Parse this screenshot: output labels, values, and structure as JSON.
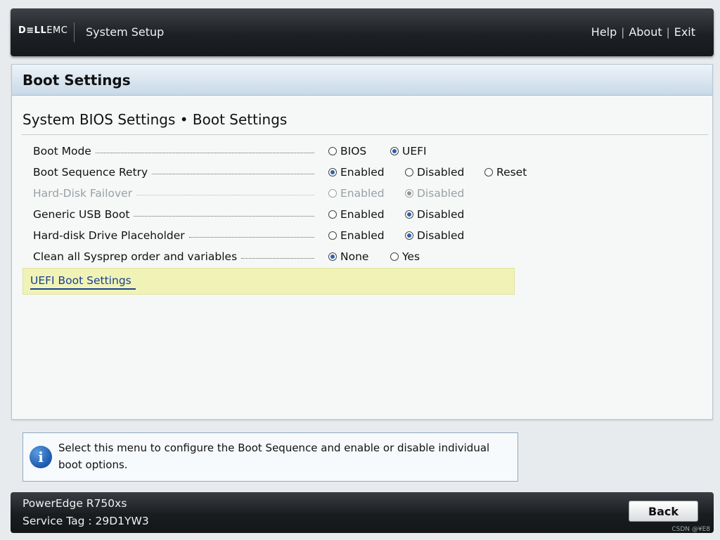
{
  "header": {
    "logo_dell": "D≡LL",
    "logo_emc": "EMC",
    "title": "System Setup",
    "links": [
      "Help",
      "About",
      "Exit"
    ],
    "separator": "|"
  },
  "panel": {
    "title": "Boot Settings",
    "breadcrumb": "System BIOS Settings • Boot Settings",
    "rows": [
      {
        "label": "Boot Mode",
        "disabled": false,
        "options": [
          "BIOS",
          "UEFI"
        ],
        "selected": 1
      },
      {
        "label": "Boot Sequence Retry",
        "disabled": false,
        "options": [
          "Enabled",
          "Disabled",
          "Reset"
        ],
        "selected": 0
      },
      {
        "label": "Hard-Disk Failover",
        "disabled": true,
        "options": [
          "Enabled",
          "Disabled"
        ],
        "selected": 1
      },
      {
        "label": "Generic USB Boot",
        "disabled": false,
        "options": [
          "Enabled",
          "Disabled"
        ],
        "selected": 1
      },
      {
        "label": "Hard-disk Drive Placeholder",
        "disabled": false,
        "options": [
          "Enabled",
          "Disabled"
        ],
        "selected": 1
      },
      {
        "label": "Clean all Sysprep order and variables",
        "disabled": false,
        "options": [
          "None",
          "Yes"
        ],
        "selected": 0
      }
    ],
    "submenu_link": "UEFI Boot Settings"
  },
  "info": {
    "icon": "info-icon",
    "text": "Select this menu to configure the Boot Sequence and enable or disable individual boot options."
  },
  "footer": {
    "model": "PowerEdge R750xs",
    "service_tag": "Service Tag : 29D1YW3",
    "back_label": "Back"
  },
  "watermark": "CSDN @¥E8"
}
